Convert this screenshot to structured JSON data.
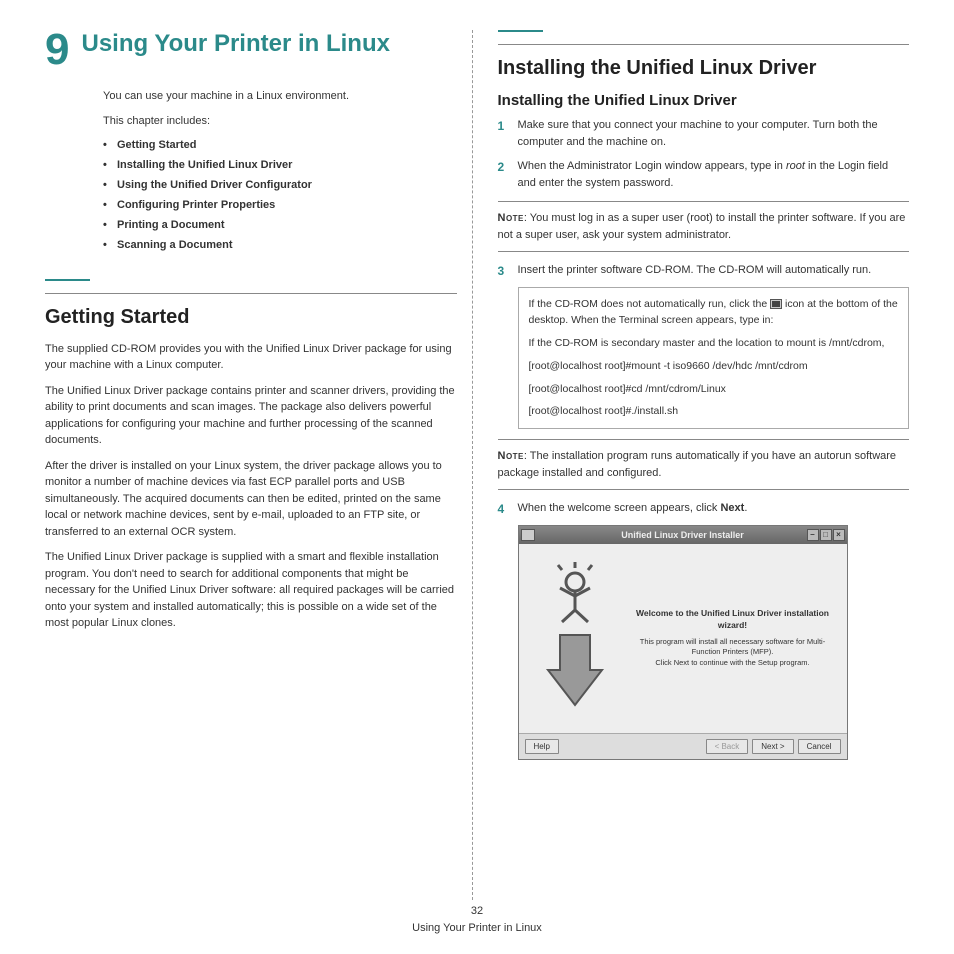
{
  "chapter": {
    "number": "9",
    "title": "Using Your Printer in Linux"
  },
  "intro": {
    "p1": "You can use your machine in a Linux environment.",
    "p2": "This chapter includes:"
  },
  "toc": [
    "Getting Started",
    "Installing the Unified Linux Driver",
    "Using the Unified Driver Configurator",
    "Configuring Printer Properties",
    "Printing a Document",
    "Scanning a Document"
  ],
  "getting_started": {
    "heading": "Getting Started",
    "p1": "The supplied CD-ROM provides you with the Unified Linux Driver package for using your machine with a Linux computer.",
    "p2": "The Unified Linux Driver package contains printer and scanner drivers, providing the ability to print documents and scan images. The package also delivers powerful applications for configuring your machine and further processing of the scanned documents.",
    "p3": "After the driver is installed on your Linux system, the driver package allows you to monitor a number of machine devices via fast ECP parallel ports and USB simultaneously. The acquired documents can then be edited, printed on the same local or network machine devices, sent by e-mail, uploaded to an FTP site, or transferred to an external OCR system.",
    "p4": "The Unified Linux Driver package is supplied with a smart and flexible installation program. You don't need to search for additional components that might be necessary for the Unified Linux Driver software: all required packages will be carried onto your system and installed automatically; this is possible on a wide set of the most popular Linux clones."
  },
  "installing": {
    "heading": "Installing the Unified Linux Driver",
    "sub_heading": "Installing the Unified Linux Driver",
    "step1": "Make sure that you connect your machine to your computer. Turn both the computer and the machine on.",
    "step2_a": "When the Administrator Login window appears, type in ",
    "step2_root": "root",
    "step2_b": " in the Login field and enter the system password.",
    "note1_label": "Note",
    "note1": ": You must log in as a super user (root) to install the printer software. If you are not a super user, ask your system administrator.",
    "step3": "Insert the printer software CD-ROM. The CD-ROM will automatically run.",
    "box_p1_a": "If the CD-ROM does not automatically run, click the ",
    "box_p1_b": " icon at the bottom of the desktop. When the Terminal screen appears, type in:",
    "box_p2": "If the CD-ROM is secondary master and the location to mount is /mnt/cdrom,",
    "box_cmd1": "[root@localhost root]#mount -t iso9660 /dev/hdc /mnt/cdrom",
    "box_cmd2": "[root@localhost root]#cd /mnt/cdrom/Linux",
    "box_cmd3": "[root@localhost root]#./install.sh",
    "note2_label": "Note",
    "note2": ": The installation program runs automatically if you have an autorun software package installed and configured.",
    "step4_a": "When the welcome screen appears, click ",
    "step4_b": "Next",
    "step4_c": "."
  },
  "screenshot": {
    "title": "Unified Linux Driver Installer",
    "welcome": "Welcome to the Unified Linux Driver installation wizard!",
    "desc1": "This program will install all necessary software for Multi-Function Printers (MFP).",
    "desc2": "Click Next to continue with the Setup program.",
    "btn_help": "Help",
    "btn_back": "< Back",
    "btn_next": "Next >",
    "btn_cancel": "Cancel"
  },
  "footer": {
    "page": "32",
    "title": "Using Your Printer in Linux"
  }
}
